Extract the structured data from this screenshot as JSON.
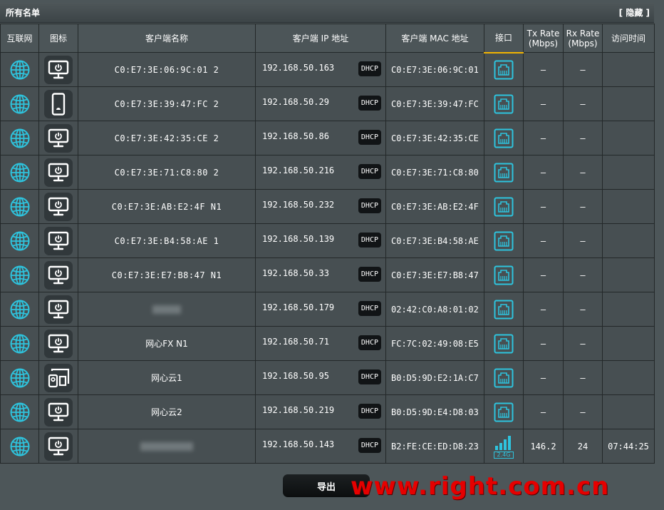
{
  "header": {
    "title": "所有名单",
    "hide_label": "[ 隐藏 ]"
  },
  "columns": {
    "internet": "互联网",
    "icon": "图标",
    "client_name": "客户端名称",
    "client_ip": "客户端 IP 地址",
    "client_mac": "客户端 MAC 地址",
    "interface": "接口",
    "tx_rate": "Tx Rate",
    "tx_unit": "(Mbps)",
    "rx_rate": "Rx Rate",
    "rx_unit": "(Mbps)",
    "access_time": "访问时间"
  },
  "dhcp_label": "DHCP",
  "rows": [
    {
      "device": "monitor",
      "name": "C0:E7:3E:06:9C:01 2",
      "ip": "192.168.50.163",
      "mac": "C0:E7:3E:06:9C:01",
      "iface": "wired",
      "tx": "–",
      "rx": "–",
      "time": ""
    },
    {
      "device": "phone",
      "name": "C0:E7:3E:39:47:FC 2",
      "ip": "192.168.50.29",
      "mac": "C0:E7:3E:39:47:FC",
      "iface": "wired",
      "tx": "–",
      "rx": "–",
      "time": ""
    },
    {
      "device": "monitor",
      "name": "C0:E7:3E:42:35:CE 2",
      "ip": "192.168.50.86",
      "mac": "C0:E7:3E:42:35:CE",
      "iface": "wired",
      "tx": "–",
      "rx": "–",
      "time": ""
    },
    {
      "device": "monitor",
      "name": "C0:E7:3E:71:C8:80 2",
      "ip": "192.168.50.216",
      "mac": "C0:E7:3E:71:C8:80",
      "iface": "wired",
      "tx": "–",
      "rx": "–",
      "time": ""
    },
    {
      "device": "monitor",
      "name": "C0:E7:3E:AB:E2:4F N1",
      "ip": "192.168.50.232",
      "mac": "C0:E7:3E:AB:E2:4F",
      "iface": "wired",
      "tx": "–",
      "rx": "–",
      "time": ""
    },
    {
      "device": "monitor",
      "name": "C0:E7:3E:B4:58:AE 1",
      "ip": "192.168.50.139",
      "mac": "C0:E7:3E:B4:58:AE",
      "iface": "wired",
      "tx": "–",
      "rx": "–",
      "time": ""
    },
    {
      "device": "monitor",
      "name": "C0:E7:3E:E7:B8:47 N1",
      "ip": "192.168.50.33",
      "mac": "C0:E7:3E:E7:B8:47",
      "iface": "wired",
      "tx": "–",
      "rx": "–",
      "time": ""
    },
    {
      "device": "monitor",
      "name": "",
      "blurred": true,
      "ip": "192.168.50.179",
      "mac": "02:42:C0:A8:01:02",
      "iface": "wired",
      "tx": "–",
      "rx": "–",
      "time": ""
    },
    {
      "device": "monitor",
      "name": "网心FX N1",
      "ip": "192.168.50.71",
      "mac": "FC:7C:02:49:08:E5",
      "iface": "wired",
      "tx": "–",
      "rx": "–",
      "time": ""
    },
    {
      "device": "devices",
      "name": "网心云1",
      "ip": "192.168.50.95",
      "mac": "B0:D5:9D:E2:1A:C7",
      "iface": "wired",
      "tx": "–",
      "rx": "–",
      "time": ""
    },
    {
      "device": "monitor",
      "name": "网心云2",
      "ip": "192.168.50.219",
      "mac": "B0:D5:9D:E4:D8:03",
      "iface": "wired",
      "tx": "–",
      "rx": "–",
      "time": ""
    },
    {
      "device": "monitor",
      "name": "",
      "blurred": true,
      "ip": "192.168.50.143",
      "mac": "B2:FE:CE:ED:D8:23",
      "iface": "wifi",
      "band": "2.4G",
      "tx": "146.2",
      "rx": "24",
      "time": "07:44:25"
    }
  ],
  "export_label": "导出",
  "watermark": "www.right.com.cn",
  "colors": {
    "accent": "#2ec4de",
    "active_tab": "#f2b300",
    "watermark": "#e60000"
  }
}
